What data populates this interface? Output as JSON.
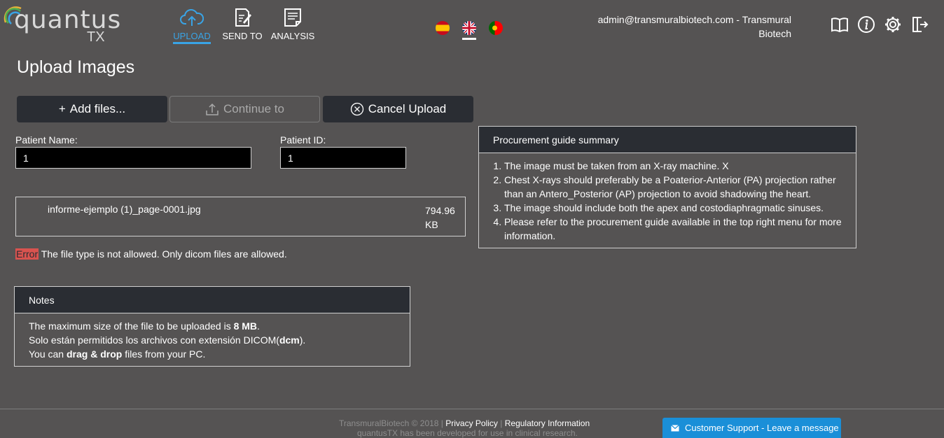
{
  "header": {
    "logo_text": "quantus",
    "logo_sub": "TX",
    "nav": [
      {
        "label": "UPLOAD",
        "icon": "cloud-upload-icon"
      },
      {
        "label": "SEND TO",
        "icon": "document-edit-icon"
      },
      {
        "label": "ANALYSIS",
        "icon": "document-lines-icon"
      }
    ],
    "user": "admin@transmuralbiotech.com - Transmural Biotech",
    "tools": [
      "book-icon",
      "info-icon",
      "gear-icon",
      "logout-icon"
    ]
  },
  "main": {
    "title": "Upload Images",
    "buttons": {
      "add": "Add files...",
      "continue": "Continue to",
      "cancel": "Cancel Upload"
    },
    "patient_name": {
      "label": "Patient Name:",
      "value": "1"
    },
    "patient_id": {
      "label": "Patient ID:",
      "value": "1"
    },
    "file": {
      "name": "informe-ejemplo (1)_page-0001.jpg",
      "size": "794.96 KB"
    },
    "error": {
      "tag": "Error",
      "message": " The file type is not allowed. Only dicom files are allowed."
    }
  },
  "procurement": {
    "title": "Procurement guide summary",
    "items": [
      "The image must be taken from an X-ray machine. X",
      "Chest X-rays should preferably be a Poaterior-Anterior (PA) projection rather than an Antero_Posterior (AP) projection to avoid shadowing the heart.",
      "The image should include both the apex and costodiaphragmatic sinuses.",
      "Please refer to the procurement guide available in the top right menu for more information."
    ]
  },
  "notes": {
    "title": "Notes",
    "line1_pre": "The maximum size of the file to be uploaded is ",
    "line1_bold": "8 MB",
    "line1_post": ".",
    "line2_pre": "Solo están permitidos los archivos con extensión DICOM(",
    "line2_bold": "dcm",
    "line2_post": ").",
    "line3_pre": "You can ",
    "line3_bold": "drag & drop",
    "line3_post": " files from your PC."
  },
  "footer": {
    "copyright": "TransmuralBiotech © 2018 | ",
    "privacy": "Privacy Policy",
    "sep": " | ",
    "regulatory": "Regulatory Information",
    "disclaimer": "quantusTX has been developed for use in clinical research.",
    "support": "Customer Support - Leave a message"
  },
  "colors": {
    "accent": "#39a4e6",
    "error": "#d9534f",
    "panel": "#2a2d33",
    "support": "#1a8fd8"
  }
}
